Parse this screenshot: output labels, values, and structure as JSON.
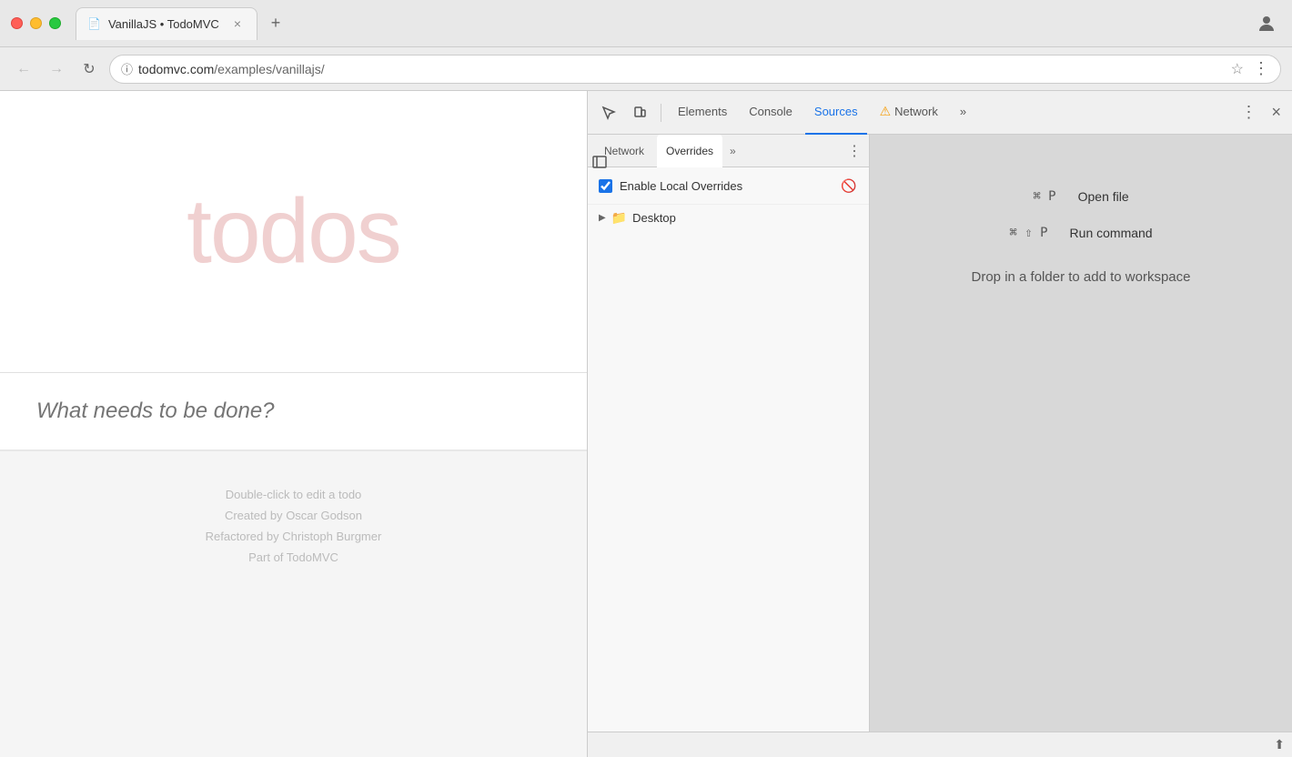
{
  "browser": {
    "tab_title": "VanillaJS • TodoMVC",
    "tab_favicon": "📄",
    "url_secure": "ⓘ",
    "url_text_domain": "todomvc.com",
    "url_text_path": "/examples/vanillajs/",
    "new_tab_label": "+",
    "close_label": "×"
  },
  "webpage": {
    "title": "todos",
    "input_placeholder": "What needs to be done?",
    "footer_hint": "Double-click to edit a todo",
    "footer_created": "Created by",
    "footer_creator": "Oscar Godson",
    "footer_refactored": "Refactored by",
    "footer_refactorer": "Christoph Burgmer",
    "footer_part": "Part of",
    "footer_todomvc": "TodoMVC"
  },
  "devtools": {
    "tabs": [
      {
        "id": "elements",
        "label": "Elements",
        "active": false,
        "warning": false
      },
      {
        "id": "console",
        "label": "Console",
        "active": false,
        "warning": false
      },
      {
        "id": "sources",
        "label": "Sources",
        "active": true,
        "warning": false
      },
      {
        "id": "network",
        "label": "Network",
        "active": false,
        "warning": true
      },
      {
        "id": "more",
        "label": "»",
        "active": false,
        "warning": false
      }
    ],
    "subtabs": [
      {
        "id": "network",
        "label": "Network",
        "active": false
      },
      {
        "id": "overrides",
        "label": "Overrides",
        "active": true
      },
      {
        "id": "more",
        "label": "»",
        "active": false
      }
    ],
    "enable_overrides": {
      "label": "Enable Local Overrides",
      "checked": true
    },
    "file_tree": [
      {
        "name": "Desktop",
        "type": "folder",
        "expanded": false
      }
    ],
    "shortcuts": [
      {
        "key": "⌘ P",
        "label": "Open file"
      },
      {
        "key": "⌘ ⇧ P",
        "label": "Run command"
      }
    ],
    "drop_hint": "Drop in a folder to add to workspace"
  },
  "icons": {
    "inspect": "⬚",
    "device": "▱",
    "close": "×",
    "menu": "⋮",
    "back": "←",
    "forward": "→",
    "refresh": "↻",
    "star": "☆",
    "chevron_right": "▶",
    "more_vert": "⋮",
    "no": "🚫",
    "panel_left": "◧",
    "clear": "🚫"
  }
}
